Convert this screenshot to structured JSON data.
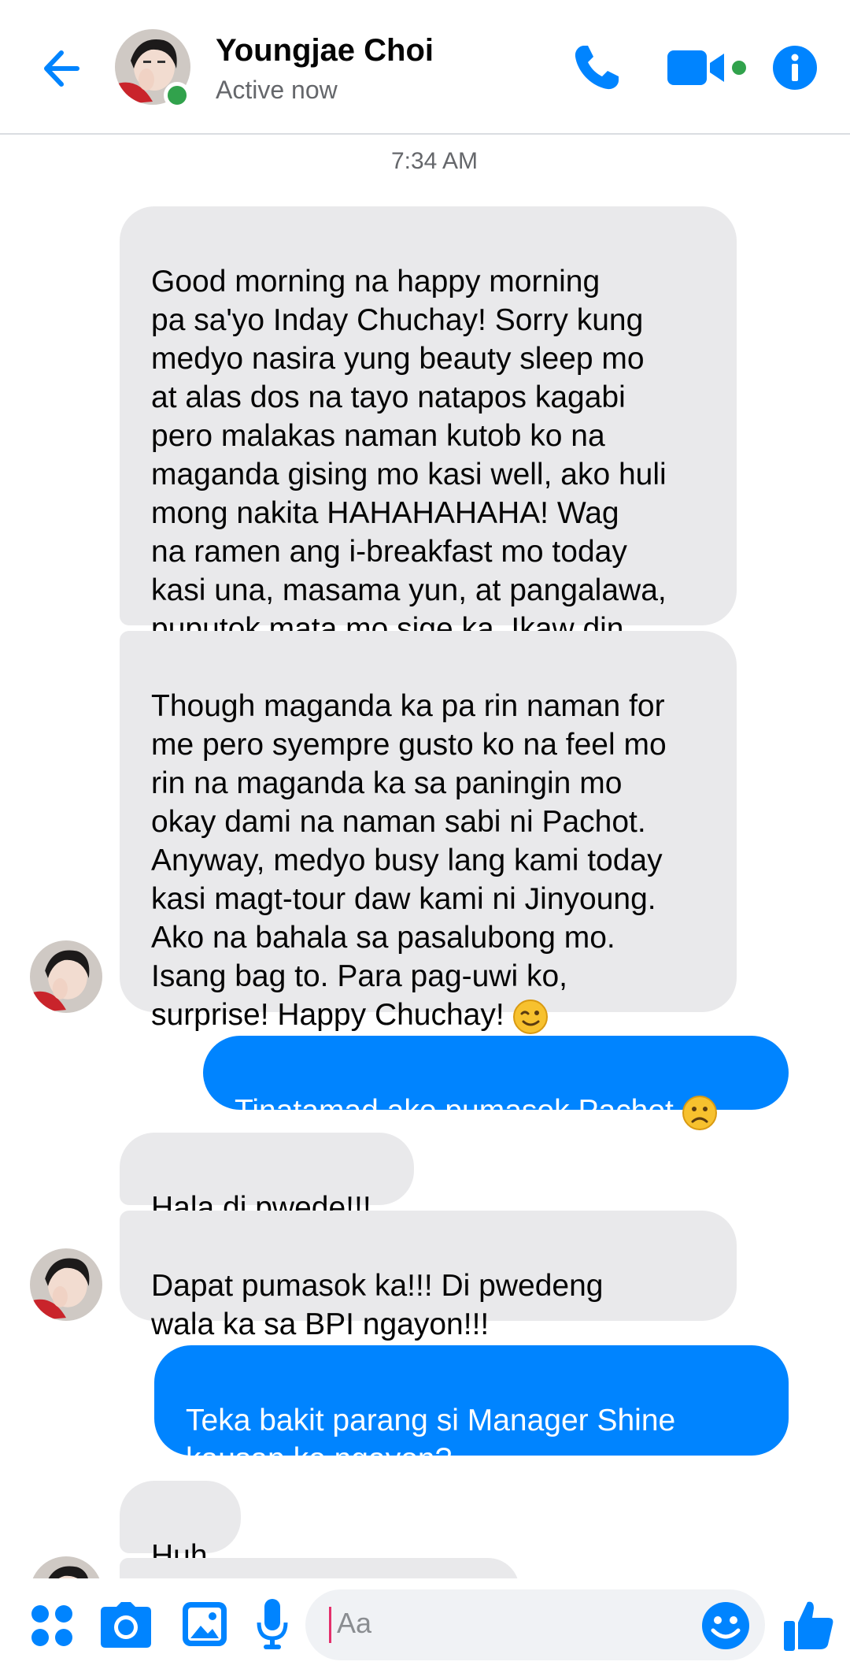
{
  "header": {
    "contact_name": "Youngjae Choi",
    "status": "Active now",
    "icons": [
      "back-arrow-icon",
      "phone-icon",
      "video-camera-icon",
      "info-icon"
    ],
    "accent_color": "#0084ff",
    "online_color": "#31a24c"
  },
  "conversation": {
    "timestamp": "7:34 AM",
    "messages": [
      {
        "from": "them",
        "text": "Good morning na happy morning\npa sa'yo Inday Chuchay! Sorry kung\nmedyo nasira yung beauty sleep mo\nat alas dos na tayo natapos kagabi\npero malakas naman kutob ko na\nmaganda gising mo kasi well, ako huli\nmong nakita HAHAHAHAHA! Wag\nna ramen ang i-breakfast mo today\nkasi una, masama yun, at pangalawa,\npuputok mata mo sige ka. Ikaw din."
      },
      {
        "from": "them",
        "text": "Though maganda ka pa rin naman for\nme pero syempre gusto ko na feel mo\nrin na maganda ka sa paningin mo\nokay dami na naman sabi ni Pachot.\nAnyway, medyo busy lang kami today\nkasi magt-tour daw kami ni Jinyoung.\nAko na bahala sa pasalubong mo.\nIsang bag to. Para pag-uwi ko,\nsurprise! Happy Chuchay!",
        "emoji": "wink-emoji"
      },
      {
        "from": "me",
        "text": "Tinatamad ako pumasok Pachot",
        "emoji": "frown-emoji"
      },
      {
        "from": "them",
        "text": "Hala di pwede!!!"
      },
      {
        "from": "them",
        "text": "Dapat pumasok ka!!! Di pwedeng\nwala ka sa BPI ngayon!!!"
      },
      {
        "from": "me",
        "text": "Teka bakit parang si Manager Shine\nkausap ko ngayon?"
      },
      {
        "from": "them",
        "text": "Huh"
      }
    ]
  },
  "composer": {
    "placeholder": "Aa",
    "icons": [
      "apps-icon",
      "camera-icon",
      "gallery-icon",
      "microphone-icon",
      "emoji-icon",
      "thumbs-up-icon"
    ]
  }
}
